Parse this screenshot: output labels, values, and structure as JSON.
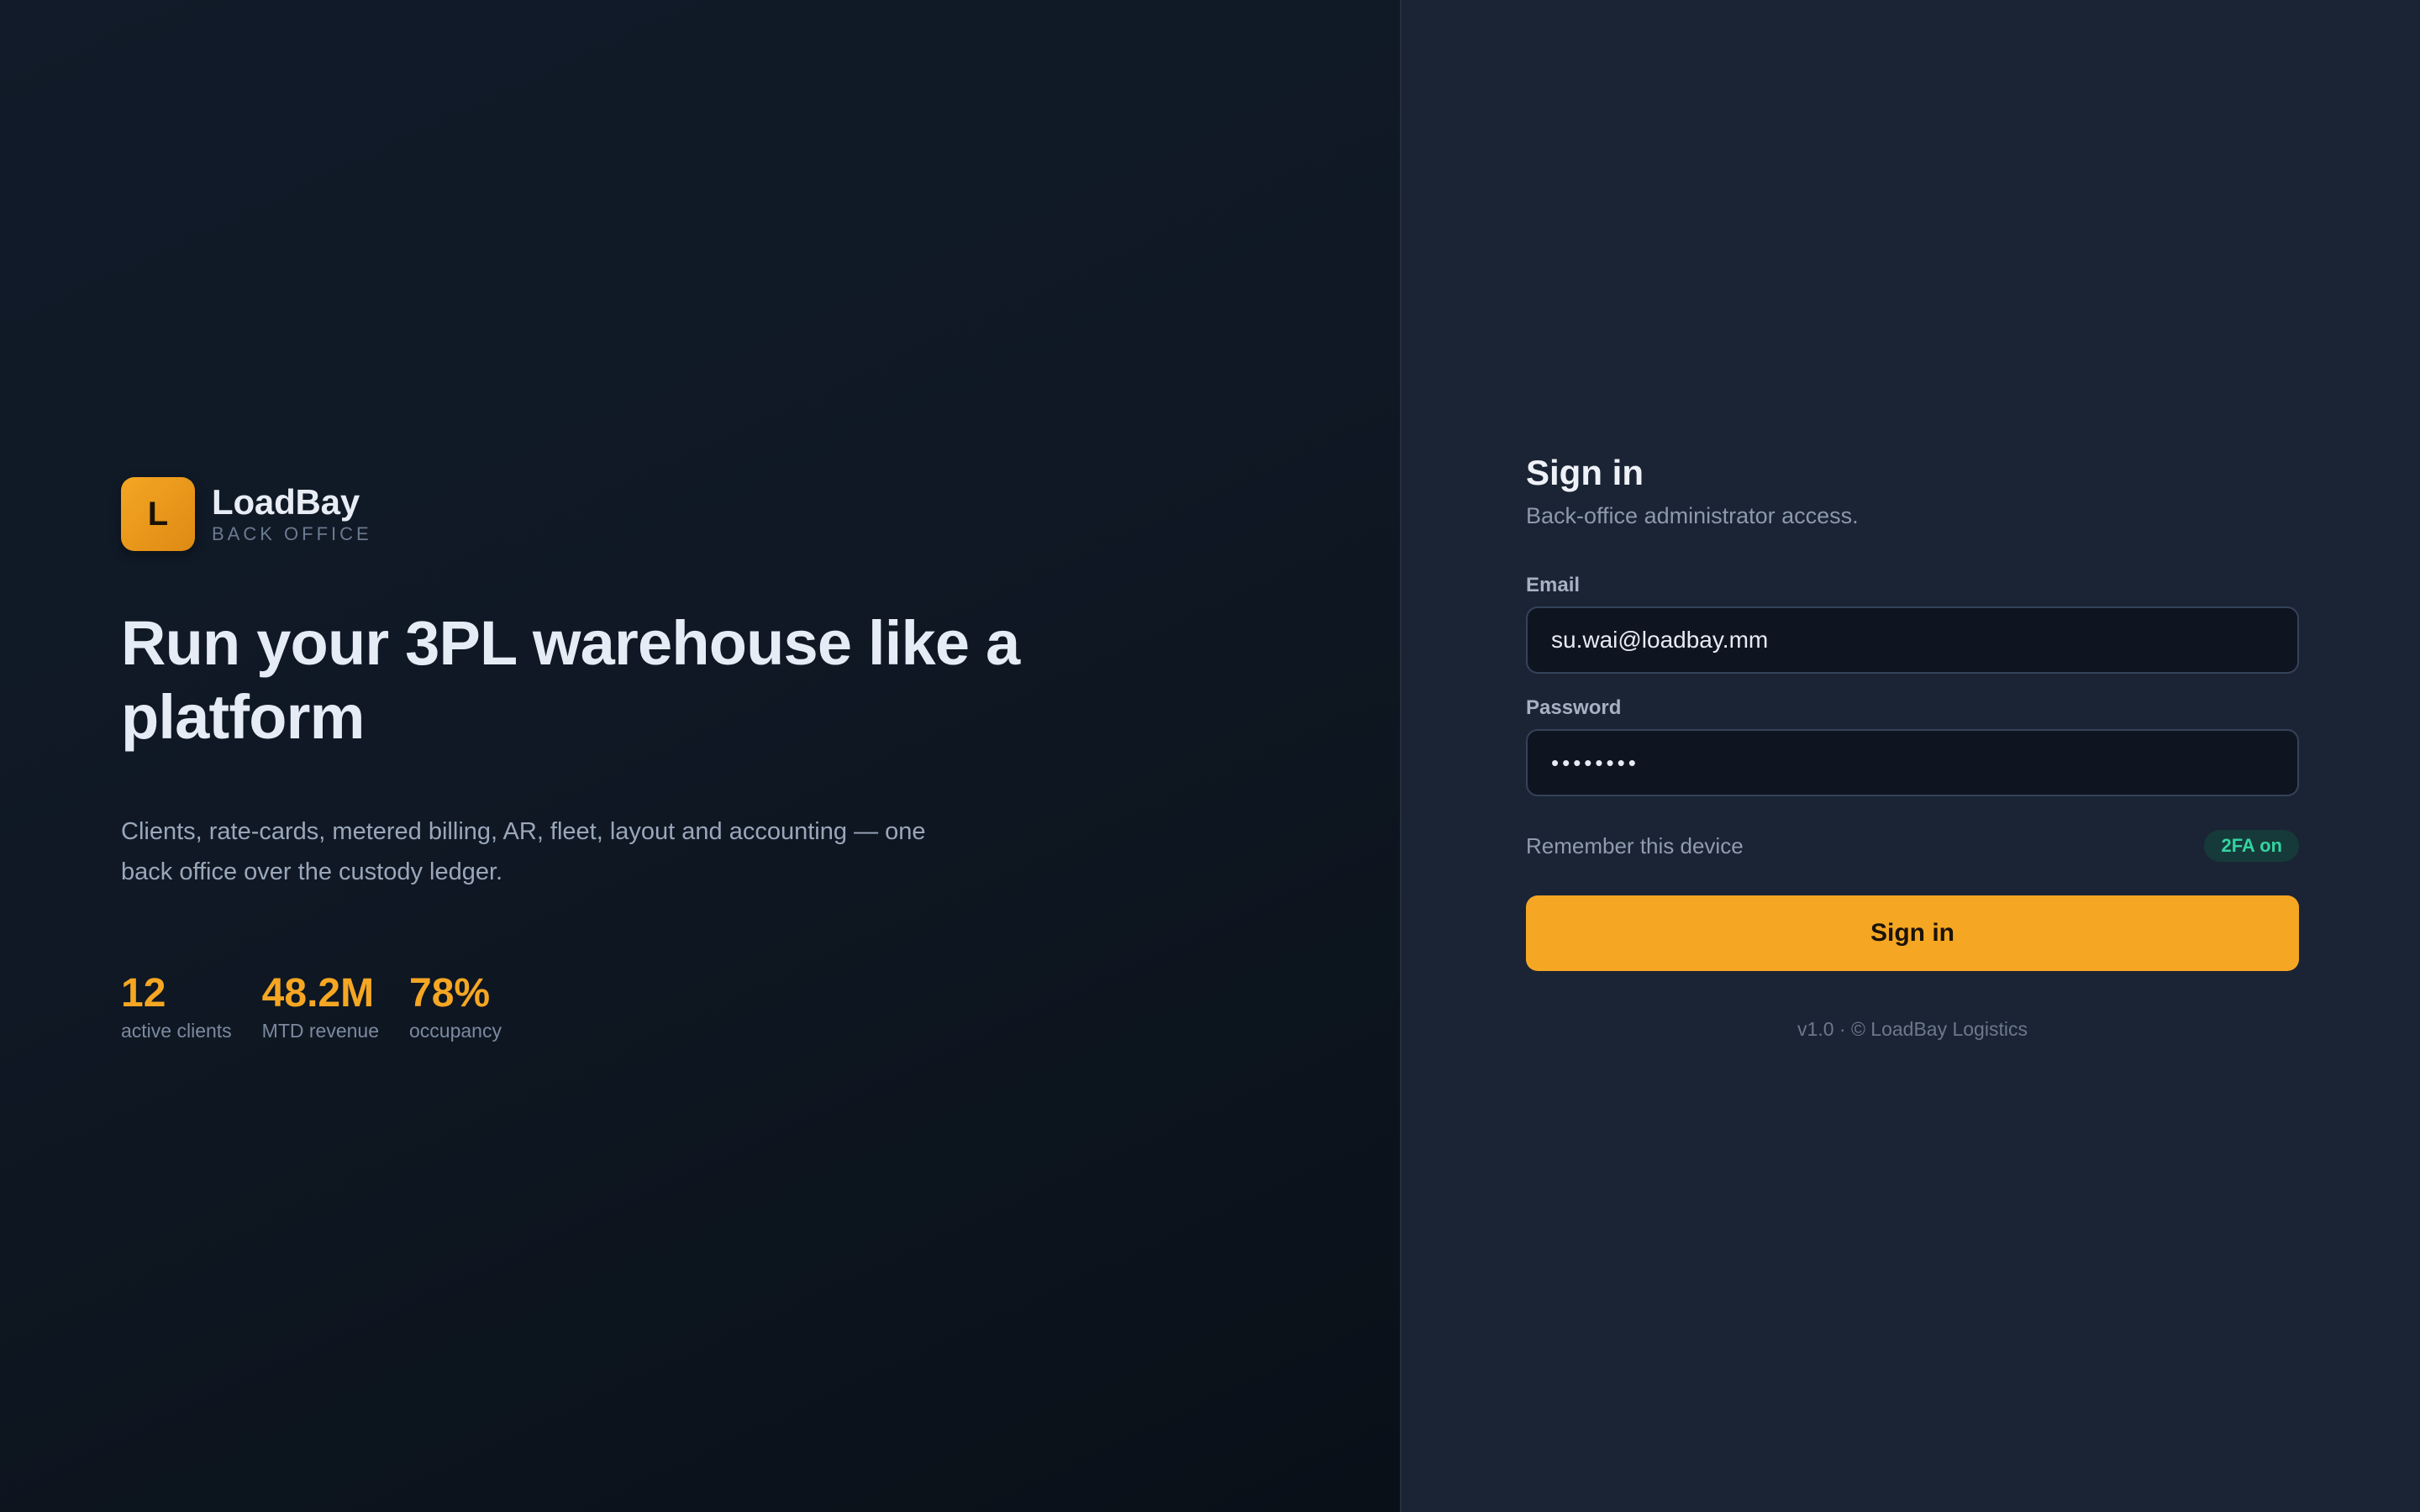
{
  "brand": {
    "logo_letter": "L",
    "name": "LoadBay",
    "subtitle": "BACK OFFICE",
    "accent_color": "#f5a623"
  },
  "hero": {
    "headline": "Run your 3PL warehouse like a platform",
    "tagline": "Clients, rate-cards, metered billing, AR, fleet, layout and accounting — one back office over the custody ledger.",
    "stats": [
      {
        "value": "12",
        "label": "active clients"
      },
      {
        "value": "48.2M",
        "label": "MTD revenue"
      },
      {
        "value": "78%",
        "label": "occupancy"
      }
    ]
  },
  "auth": {
    "title": "Sign in",
    "subtitle": "Back-office administrator access.",
    "email": {
      "label": "Email",
      "value": "su.wai@loadbay.mm"
    },
    "password": {
      "label": "Password",
      "value": "••••••••"
    },
    "remember_label": "Remember this device",
    "twofa_badge": "2FA on",
    "twofa_color": "#34d3a0",
    "submit_label": "Sign in",
    "footer": "v1.0 · © LoadBay Logistics"
  }
}
